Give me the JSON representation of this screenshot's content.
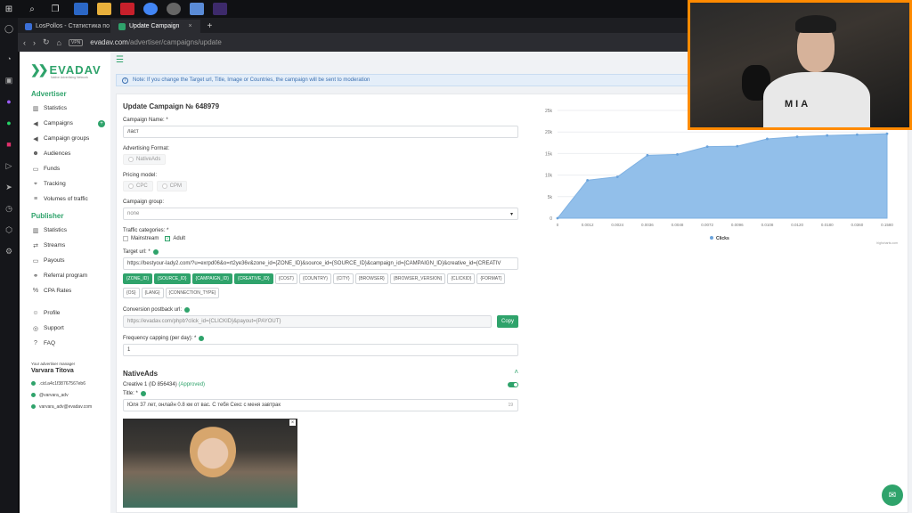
{
  "browser": {
    "tabs": [
      {
        "label": "LosPollos - Статистика по",
        "icon_color": "#3b6fd6"
      },
      {
        "label": "Update Campaign",
        "icon_color": "#2fa36b"
      }
    ],
    "new_tab": "+",
    "url_prefix": "evadav.com",
    "url_path": "/advertiser/campaigns/update",
    "vpn_label": "VPN"
  },
  "sidebar": {
    "logo": "EVADAV",
    "logo_subtitle": "Native Advertising Network",
    "advertiser_title": "Advertiser",
    "advertiser_items": [
      {
        "label": "Statistics",
        "icon": "chart-icon"
      },
      {
        "label": "Campaigns",
        "icon": "megaphone-icon",
        "badge": "+"
      },
      {
        "label": "Campaign groups",
        "icon": "megaphone-icon"
      },
      {
        "label": "Audiences",
        "icon": "users-icon"
      },
      {
        "label": "Funds",
        "icon": "wallet-icon"
      },
      {
        "label": "Tracking",
        "icon": "tracking-icon"
      },
      {
        "label": "Volumes of traffic",
        "icon": "volume-icon"
      }
    ],
    "publisher_title": "Publisher",
    "publisher_items": [
      {
        "label": "Statistics",
        "icon": "chart-icon"
      },
      {
        "label": "Streams",
        "icon": "streams-icon"
      },
      {
        "label": "Payouts",
        "icon": "wallet-icon"
      },
      {
        "label": "Referral program",
        "icon": "referral-icon"
      },
      {
        "label": "CPA Rates",
        "icon": "rates-icon"
      }
    ],
    "account_items": [
      {
        "label": "Profile",
        "icon": "user-icon"
      },
      {
        "label": "Support",
        "icon": "support-icon"
      },
      {
        "label": "FAQ",
        "icon": "faq-icon"
      }
    ],
    "manager_caption": "Your advertiser manager",
    "manager_name": "Varvara Titova",
    "manager_contacts": [
      ".cid.a4c1f38767567eb6",
      "@varvara_adv",
      "varvara_adv@evadav.com"
    ]
  },
  "notice": "Note: If you change the Target url, Title, Image or Countries, the campaign will be sent to moderation",
  "form": {
    "title": "Update Campaign № 648979",
    "campaign_name_label": "Campaign Name: *",
    "campaign_name_value": "ласт",
    "ad_format_label": "Advertising Format:",
    "ad_format_value": "NativeAds",
    "pricing_label": "Pricing model:",
    "pricing_options": [
      "CPC",
      "CPM"
    ],
    "group_label": "Campaign group:",
    "group_value": "none",
    "traffic_label": "Traffic categories: *",
    "traffic_options": [
      {
        "label": "Mainstream",
        "checked": false
      },
      {
        "label": "Adult",
        "checked": true
      }
    ],
    "target_label": "Target url: *",
    "target_value": "https://bestyour-lady2.com/?u=exrpd06&o=rt2ye36v&zone_id={ZONE_ID}&source_id={SOURCE_ID}&campaign_id={CAMPAIGN_ID}&creative_id={CREATIV",
    "macros": [
      {
        "label": "{ZONE_ID}",
        "on": true
      },
      {
        "label": "{SOURCE_ID}",
        "on": true
      },
      {
        "label": "{CAMPAIGN_ID}",
        "on": true
      },
      {
        "label": "{CREATIVE_ID}",
        "on": true
      },
      {
        "label": "{COST}",
        "on": false
      },
      {
        "label": "{COUNTRY}",
        "on": false
      },
      {
        "label": "{CITY}",
        "on": false
      },
      {
        "label": "{BROWSER}",
        "on": false
      },
      {
        "label": "{BROWSER_VERSION}",
        "on": false
      },
      {
        "label": "{CLICKID}",
        "on": false
      },
      {
        "label": "{FORMAT}",
        "on": false
      },
      {
        "label": "{OS}",
        "on": false
      },
      {
        "label": "{LANG}",
        "on": false
      },
      {
        "label": "{CONNECTION_TYPE}",
        "on": false
      }
    ],
    "postback_label": "Conversion postback url:",
    "postback_value": "https://evadav.com/phpb?click_id={CLICKID}&payout={PAYOUT}",
    "copy_label": "Copy",
    "freq_label": "Frequency capping (per day): *",
    "freq_value": "1",
    "section_title": "NativeAds",
    "creative_label": "Creative 1 (ID 856434)",
    "creative_status": "(Approved)",
    "title_label": "Title: *",
    "title_value": "Юля 37 лет, онлайн 0.8 км от вас. С тебя Секс с меня завтрак",
    "title_counter": "19"
  },
  "chart_data": {
    "type": "area",
    "x": [
      "0",
      "0.0012",
      "0.0024",
      "0.0036",
      "0.0048",
      "0.0072",
      "0.0096",
      "0.0108",
      "0.0120",
      "0.0180",
      "0.0360",
      "0.1580"
    ],
    "series": [
      {
        "name": "Clicks",
        "values": [
          0,
          8800,
          9600,
          14600,
          14800,
          16600,
          16700,
          18400,
          18900,
          19200,
          19400,
          19600
        ]
      }
    ],
    "yticks": [
      "0",
      "5k",
      "10k",
      "15k",
      "20k",
      "25k"
    ],
    "ylim": [
      0,
      25000
    ],
    "legend": "bottom",
    "color": "#92bfea",
    "credit": "highcharts.com"
  },
  "colors": {
    "brand": "#2fa36b",
    "notice": "#3a6fb0",
    "webcam_border": "#ff8a00"
  },
  "webcam": {
    "shirt_text": "MIA"
  }
}
